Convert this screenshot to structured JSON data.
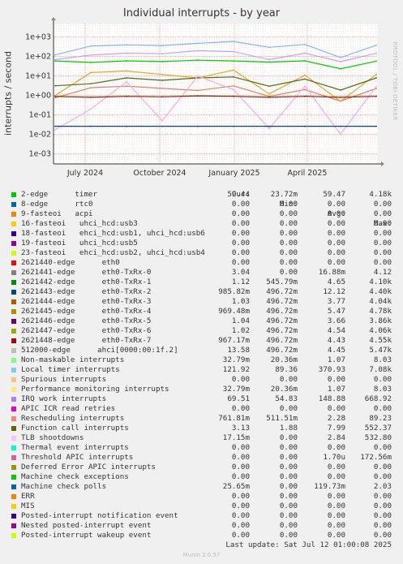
{
  "chart_data": {
    "type": "line",
    "title": "Individual interrupts - by year",
    "ylabel": "interrupts / second",
    "yscale": "log",
    "ylim": [
      0.0003,
      5000
    ],
    "y_ticks": [
      "1e-03",
      "1e-02",
      "1e-01",
      "1e+00",
      "1e+01",
      "1e+02",
      "1e+03"
    ],
    "x_ticks": [
      "July 2024",
      "October 2024",
      "January 2025",
      "April 2025"
    ],
    "grid": true,
    "series": [
      {
        "name": "2-edge      timer",
        "color": "#00cc00",
        "values": [
          59.44,
          50,
          60,
          55,
          65,
          59.47,
          52,
          60,
          23.72,
          58
        ]
      },
      {
        "name": "Local timer interrupts",
        "color": "#7eb4f5",
        "values": [
          121.92,
          350,
          400,
          370,
          480,
          600,
          300,
          420,
          89.36,
          380
        ]
      },
      {
        "name": "Rescheduling interrupts",
        "color": "#e08060",
        "values": [
          0.76,
          2.5,
          3.0,
          2.3,
          1.8,
          3.1,
          0.9,
          2.0,
          0.51,
          2.28
        ]
      },
      {
        "name": "2621443-edge      eth0-TxRx-2",
        "color": "#f0a020",
        "values": [
          0.99,
          15,
          18,
          12,
          8,
          20,
          1.2,
          11,
          0.5,
          12.12
        ]
      },
      {
        "name": "Function call interrupts",
        "color": "#4a6e1c",
        "values": [
          3.13,
          4,
          7.99,
          6,
          8,
          9,
          3,
          7,
          1.88,
          7.99
        ]
      },
      {
        "name": "IRQ work interrupts",
        "color": "#c8a0f0",
        "values": [
          69.51,
          120,
          150,
          140,
          200,
          180,
          70,
          150,
          54.83,
          148.88
        ]
      },
      {
        "name": "TLB shootdowns",
        "color": "#ffaae0",
        "values": [
          0.017,
          0.2,
          5,
          0.05,
          10,
          2,
          0.02,
          3,
          0.01,
          2.84
        ]
      },
      {
        "name": "Machine check polls",
        "color": "#0040a0",
        "values": [
          0.026,
          0.026,
          0.026,
          0.026,
          0.026,
          0.026,
          0.026,
          0.026,
          0.026,
          0.026
        ]
      },
      {
        "name": "2621442-edge      eth0-TxRx-1",
        "color": "#882200",
        "values": [
          0.89,
          0.8,
          0.9,
          0.85,
          0.95,
          0.9,
          0.8,
          0.9,
          0.8,
          0.9
        ]
      }
    ]
  },
  "legend_header": {
    "cur": "Cur:",
    "min": "Min:",
    "avg": "Avg:",
    "max": "Max:"
  },
  "legend": [
    {
      "name": "2-edge      timer",
      "color": "#00cc00",
      "cur": "59.44",
      "min": "23.72m",
      "avg": "59.47",
      "max": "4.18k"
    },
    {
      "name": "8-edge      rtc0",
      "color": "#0066b3",
      "cur": "0.00",
      "min": "0.00",
      "avg": "0.00",
      "max": "0.00"
    },
    {
      "name": "9-fasteoi   acpi",
      "color": "#ff8000",
      "cur": "0.00",
      "min": "0.00",
      "avg": "0.00",
      "max": "0.00"
    },
    {
      "name": "16-fasteoi   uhci_hcd:usb3",
      "color": "#ffcc00",
      "cur": "0.00",
      "min": "0.00",
      "avg": "0.00",
      "max": "0.00"
    },
    {
      "name": "18-fasteoi   ehci_hcd:usb1, uhci_hcd:usb6",
      "color": "#330099",
      "cur": "0.00",
      "min": "0.00",
      "avg": "0.00",
      "max": "0.00"
    },
    {
      "name": "19-fasteoi   uhci_hcd:usb5",
      "color": "#990099",
      "cur": "0.00",
      "min": "0.00",
      "avg": "0.00",
      "max": "0.00"
    },
    {
      "name": "23-fasteoi   ehci_hcd:usb2, uhci_hcd:usb4",
      "color": "#ccff00",
      "cur": "0.00",
      "min": "0.00",
      "avg": "0.00",
      "max": "0.00"
    },
    {
      "name": "2621440-edge      eth0",
      "color": "#ff0000",
      "cur": "0.00",
      "min": "0.00",
      "avg": "0.00",
      "max": "0.00"
    },
    {
      "name": "2621441-edge      eth0-TxRx-0",
      "color": "#808080",
      "cur": "3.04",
      "min": "0.00",
      "avg": "16.88m",
      "max": "4.12"
    },
    {
      "name": "2621442-edge      eth0-TxRx-1",
      "color": "#008f00",
      "cur": "1.12",
      "min": "545.79m",
      "avg": "4.65",
      "max": "4.10k"
    },
    {
      "name": "2621443-edge      eth0-TxRx-2",
      "color": "#00487d",
      "cur": "985.82m",
      "min": "496.72m",
      "avg": "12.12",
      "max": "4.40k"
    },
    {
      "name": "2621444-edge      eth0-TxRx-3",
      "color": "#b35a00",
      "cur": "1.03",
      "min": "496.72m",
      "avg": "3.77",
      "max": "4.04k"
    },
    {
      "name": "2621445-edge      eth0-TxRx-4",
      "color": "#b38f00",
      "cur": "969.48m",
      "min": "496.72m",
      "avg": "5.47",
      "max": "4.78k"
    },
    {
      "name": "2621446-edge      eth0-TxRx-5",
      "color": "#6b006b",
      "cur": "1.04",
      "min": "496.72m",
      "avg": "3.66",
      "max": "3.86k"
    },
    {
      "name": "2621447-edge      eth0-TxRx-6",
      "color": "#8fb300",
      "cur": "1.02",
      "min": "496.72m",
      "avg": "4.54",
      "max": "4.06k"
    },
    {
      "name": "2621448-edge      eth0-TxRx-7",
      "color": "#b30000",
      "cur": "967.17m",
      "min": "496.72m",
      "avg": "4.43",
      "max": "4.55k"
    },
    {
      "name": "512000-edge      ahci[0000:00:1f.2]",
      "color": "#bebebe",
      "cur": "13.58",
      "min": "496.72m",
      "avg": "4.45",
      "max": "5.47k"
    },
    {
      "name": "Non-maskable interrupts",
      "color": "#80ff80",
      "cur": "32.79m",
      "min": "20.36m",
      "avg": "1.07",
      "max": "8.03"
    },
    {
      "name": "Local timer interrupts",
      "color": "#80c9ff",
      "cur": "121.92",
      "min": "89.36",
      "avg": "370.93",
      "max": "7.08k"
    },
    {
      "name": "Spurious interrupts",
      "color": "#ffc080",
      "cur": "0.00",
      "min": "0.00",
      "avg": "0.00",
      "max": "0.00"
    },
    {
      "name": "Performance monitoring interrupts",
      "color": "#ffe680",
      "cur": "32.79m",
      "min": "20.36m",
      "avg": "1.07",
      "max": "8.03"
    },
    {
      "name": "IRQ work interrupts",
      "color": "#aa80ff",
      "cur": "69.51",
      "min": "54.83",
      "avg": "148.88",
      "max": "668.92"
    },
    {
      "name": "APIC ICR read retries",
      "color": "#ee00cc",
      "cur": "0.00",
      "min": "0.00",
      "avg": "0.00",
      "max": "0.00"
    },
    {
      "name": "Rescheduling interrupts",
      "color": "#ff8080",
      "cur": "761.81m",
      "min": "511.51m",
      "avg": "2.28",
      "max": "89.23"
    },
    {
      "name": "Function call interrupts",
      "color": "#666600",
      "cur": "3.13",
      "min": "1.88",
      "avg": "7.99",
      "max": "552.37"
    },
    {
      "name": "TLB shootdowns",
      "color": "#ffbfff",
      "cur": "17.15m",
      "min": "0.00",
      "avg": "2.84",
      "max": "532.80"
    },
    {
      "name": "Thermal event interrupts",
      "color": "#00ffcc",
      "cur": "0.00",
      "min": "0.00",
      "avg": "0.00",
      "max": "0.00"
    },
    {
      "name": "Threshold APIC interrupts",
      "color": "#cc6699",
      "cur": "0.00",
      "min": "0.00",
      "avg": "1.70u",
      "max": "172.56m"
    },
    {
      "name": "Deferred Error APIC interrupts",
      "color": "#999900",
      "cur": "0.00",
      "min": "0.00",
      "avg": "0.00",
      "max": "0.00"
    },
    {
      "name": "Machine check exceptions",
      "color": "#00cc00",
      "cur": "0.00",
      "min": "0.00",
      "avg": "0.00",
      "max": "0.00"
    },
    {
      "name": "Machine check polls",
      "color": "#0066b3",
      "cur": "25.65m",
      "min": "0.00",
      "avg": "119.73m",
      "max": "2.03"
    },
    {
      "name": "ERR",
      "color": "#ff8000",
      "cur": "0.00",
      "min": "0.00",
      "avg": "0.00",
      "max": "0.00"
    },
    {
      "name": "MIS",
      "color": "#ffcc00",
      "cur": "0.00",
      "min": "0.00",
      "avg": "0.00",
      "max": "0.00"
    },
    {
      "name": "Posted-interrupt notification event",
      "color": "#330099",
      "cur": "0.00",
      "min": "0.00",
      "avg": "0.00",
      "max": "0.00"
    },
    {
      "name": "Nested posted-interrupt event",
      "color": "#990099",
      "cur": "0.00",
      "min": "0.00",
      "avg": "0.00",
      "max": "0.00"
    },
    {
      "name": "Posted-interrupt wakeup event",
      "color": "#ccff00",
      "cur": "0.00",
      "min": "0.00",
      "avg": "0.00",
      "max": "0.00"
    }
  ],
  "last_update": "Last update: Sat Jul 12 01:00:08 2025",
  "watermark": "RRDTOOL / TOBI OETIKER",
  "footer": "Munin 2.0.57"
}
